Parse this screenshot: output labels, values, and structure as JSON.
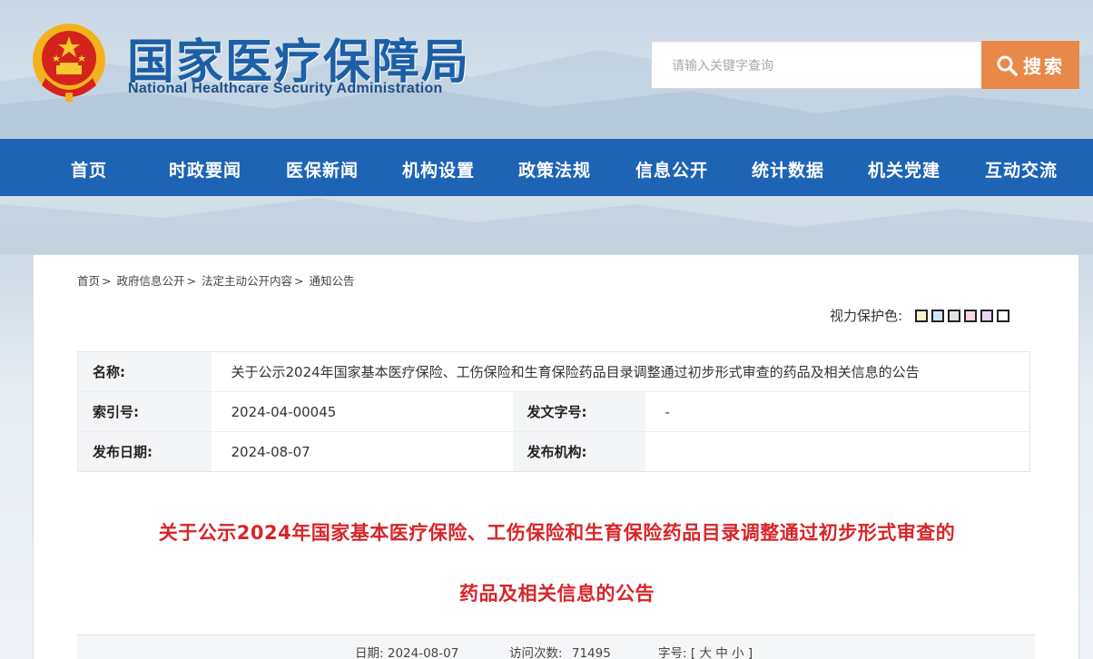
{
  "header": {
    "title": "国家医疗保障局",
    "subtitle": "National Healthcare Security Administration",
    "search_placeholder": "请输入关键字查询",
    "search_label": "搜索"
  },
  "nav": {
    "items": [
      "首页",
      "时政要闻",
      "医保新闻",
      "机构设置",
      "政策法规",
      "信息公开",
      "统计数据",
      "机关党建",
      "互动交流"
    ]
  },
  "breadcrumb": {
    "items": [
      "首页",
      "政府信息公开",
      "法定主动公开内容",
      "通知公告"
    ],
    "separator": ">"
  },
  "eye_protect": {
    "label": "视力保护色:",
    "swatches": [
      "#f7f3c8",
      "#cbe8f7",
      "#e2e2e2",
      "#f6d8dc",
      "#e8d5f2",
      "#ffffff"
    ]
  },
  "meta": {
    "name_label": "名称:",
    "name_value": "关于公示2024年国家基本医疗保险、工伤保险和生育保险药品目录调整通过初步形式审查的药品及相关信息的公告",
    "index_label": "索引号:",
    "index_value": "2024-04-00045",
    "doc_no_label": "发文字号:",
    "doc_no_value": "-",
    "date_label": "发布日期:",
    "date_value": "2024-08-07",
    "org_label": "发布机构:",
    "org_value": ""
  },
  "article": {
    "title_line1": "关于公示2024年国家基本医疗保险、工伤保险和生育保险药品目录调整通过初步形式审查的",
    "title_line2": "药品及相关信息的公告"
  },
  "info_bar": {
    "date_label": "日期:",
    "date_value": "2024-08-07",
    "visits_label": "访问次数:",
    "visits_value": "71495",
    "font_label": "字号:",
    "font_open": "[",
    "font_large": "大",
    "font_medium": "中",
    "font_small": "小",
    "font_close": "]"
  },
  "colors": {
    "nav_bg": "#1e63b4",
    "title_blue": "#1d5fa6",
    "search_btn": "#e8894a",
    "article_title": "#d8252a"
  }
}
